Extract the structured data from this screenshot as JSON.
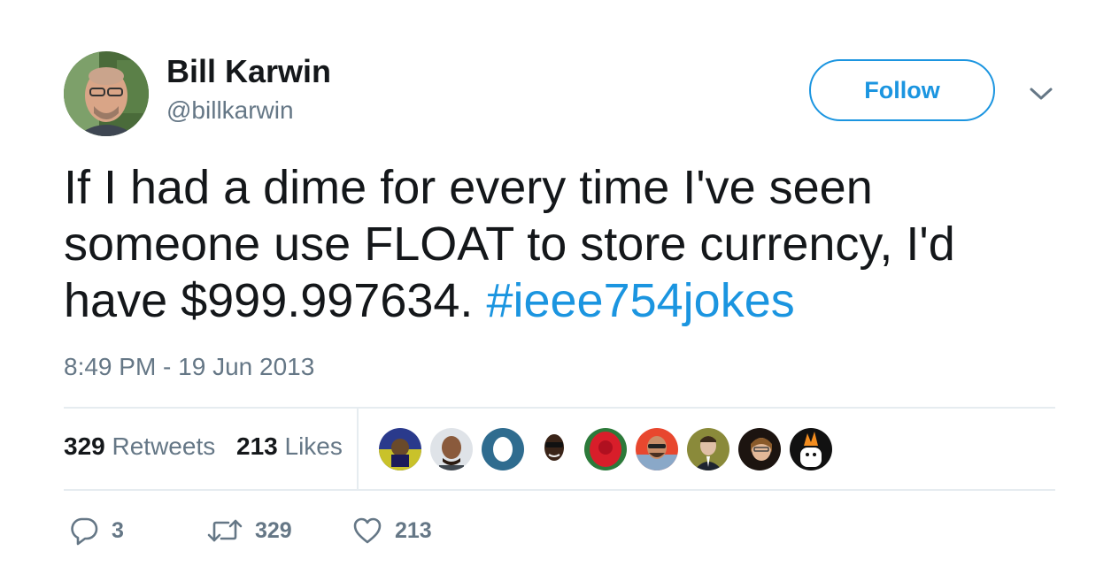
{
  "author": {
    "name": "Bill Karwin",
    "handle": "@billkarwin"
  },
  "follow_label": "Follow",
  "tweet": {
    "text": "If I had a dime for every time I've seen someone use FLOAT to store currency, I'd have $999.997634. ",
    "hashtag": "#ieee754jokes",
    "timestamp": "8:49 PM - 19 Jun 2013"
  },
  "stats": {
    "retweets_count": "329",
    "retweets_label": "Retweets",
    "likes_count": "213",
    "likes_label": "Likes"
  },
  "actions": {
    "reply_count": "3",
    "retweet_count": "329",
    "like_count": "213"
  },
  "colors": {
    "accent": "#1b95e0",
    "text": "#14171a",
    "secondary": "#657786",
    "divider": "#e6ecf0"
  }
}
